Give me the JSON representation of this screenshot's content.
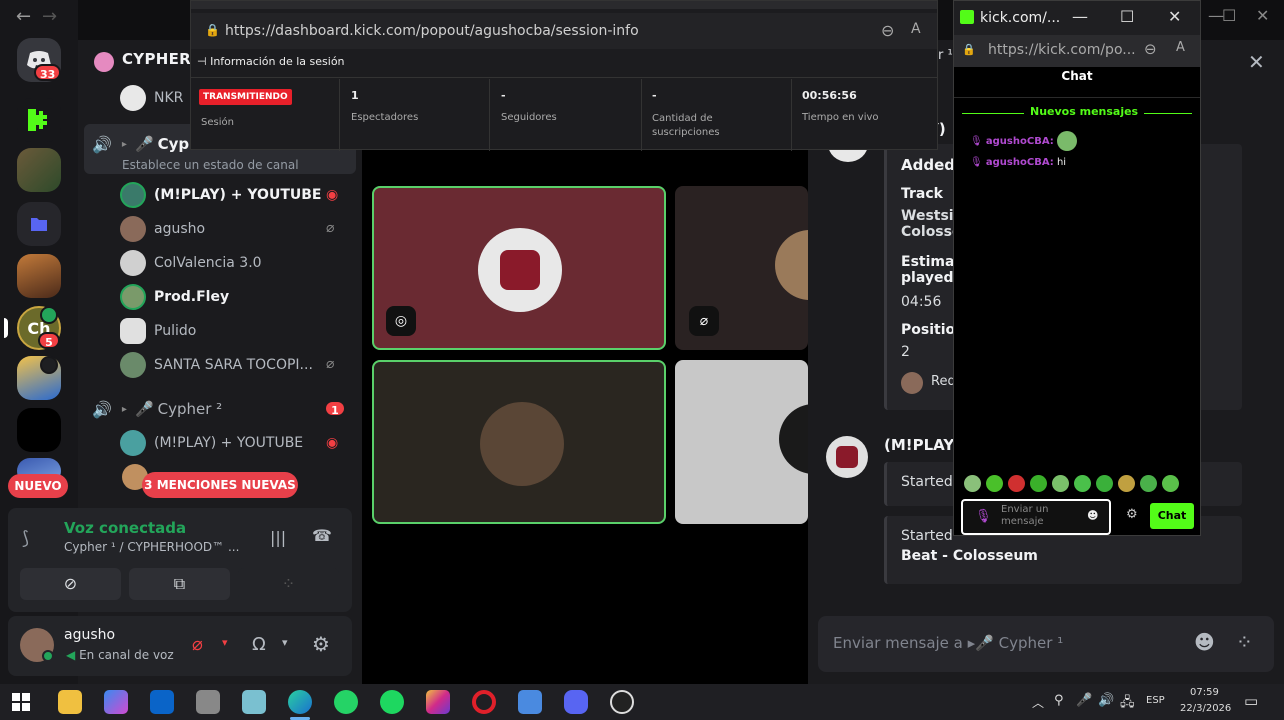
{
  "browser": {
    "back_icon": "←",
    "forward_icon": "→"
  },
  "guilds": {
    "discord_badge": "33",
    "server_badge": "5",
    "new_label": "NUEVO"
  },
  "channel_sidebar": {
    "server_name": "CYPHERI",
    "members_top": [
      {
        "name": "NKR"
      }
    ],
    "voice_channel_1": {
      "name": "Cypl",
      "status_hint": "Establece un estado de canal"
    },
    "members_1": [
      {
        "name": "(M!PLAY) + YOUTUBE",
        "bold": true
      },
      {
        "name": "agusho"
      },
      {
        "name": "ColValencia 3.0"
      },
      {
        "name": "Prod.Fley",
        "bold": true
      },
      {
        "name": "Pulido"
      },
      {
        "name": "SANTA SARA TOCOPI..."
      }
    ],
    "voice_channel_2": {
      "name": "Cypher ²",
      "badge": "1"
    },
    "members_2": [
      {
        "name": "(M!PLAY) + YOUTUBE"
      }
    ],
    "mentions_pill": "3 MENCIONES NUEVAS"
  },
  "voice_panel": {
    "status": "Voz conectada",
    "channel": "Cypher ¹ / CYPHERHOOD™ ..."
  },
  "user_panel": {
    "username": "agusho",
    "status": "En canal de voz"
  },
  "session_popup": {
    "url": "https://dashboard.kick.com/popout/agushocba/session-info",
    "title": "Información de la sesión",
    "live_badge": "TRANSMITIENDO",
    "session_label": "Sesión",
    "stats": [
      {
        "value": "1",
        "label": "Espectadores"
      },
      {
        "value": "-",
        "label": "Seguidores"
      },
      {
        "value": "-",
        "label": "Cantidad de suscripciones"
      },
      {
        "value": "00:56:56",
        "label": "Tiempo en vivo"
      }
    ]
  },
  "chat_popup": {
    "title": "kick.com/...",
    "url": "https://kick.com/po...",
    "header": "Chat",
    "new_messages": "Nuevos mensajes",
    "messages": [
      {
        "user": "agushoCBA:",
        "text": ""
      },
      {
        "user": "agushoCBA:",
        "text": "hi"
      }
    ],
    "input_placeholder": "Enviar un mensaje",
    "send_label": "Chat"
  },
  "right_panel": {
    "card1": {
      "title": "Added T",
      "track_label": "Track",
      "track_value": "Westside Colosse",
      "estimate_label": "Estimated played",
      "estimate_value": "04:56",
      "position_label": "Position",
      "position_value": "2",
      "requested": "Requ"
    },
    "author": "(M!PLAY)",
    "started1": "Started",
    "started2": "Started playing Westside Gunn - Beat - Colosseum",
    "started2_tail": "Beat - Colosseum",
    "message_input": "Enviar mensaje a",
    "channel_name": "Cypher ¹",
    "peek_text_1": "r ¹",
    "peek_text_2": "Y)"
  },
  "taskbar": {
    "lang": "ESP",
    "time": "07:59",
    "date": "22/3/2026"
  }
}
